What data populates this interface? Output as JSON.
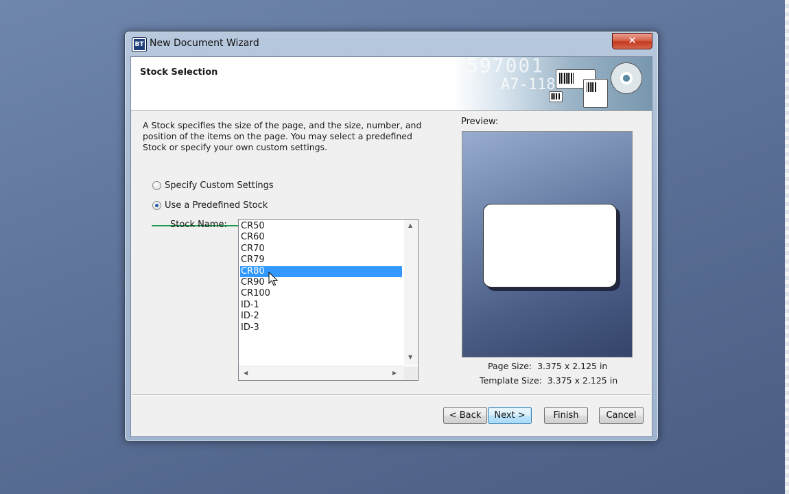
{
  "window": {
    "title": "New Document Wizard",
    "close_glyph": "✕",
    "app_icon_text": "BT"
  },
  "header": {
    "title": "Stock Selection",
    "banner_text_1": "597001",
    "banner_text_2": "A7-118"
  },
  "description": "A Stock specifies the size of the page, and the size, number, and position of the items on the page. You may select a predefined Stock or specify your own custom settings.",
  "options": {
    "custom_label": "Specify Custom Settings",
    "predefined_label": "Use a Predefined Stock",
    "selected": "predefined"
  },
  "stock": {
    "label": "Stock Name:",
    "items": [
      "CR50",
      "CR60",
      "CR70",
      "CR79",
      "CR80",
      "CR90",
      "CR100",
      "ID-1",
      "ID-2",
      "ID-3"
    ],
    "selected_index": 4
  },
  "preview": {
    "label": "Preview:",
    "page_size_label": "Page Size:",
    "page_size_value": "3.375 x 2.125 in",
    "template_size_label": "Template Size:",
    "template_size_value": "3.375 x 2.125 in"
  },
  "buttons": {
    "back": "< Back",
    "next": "Next >",
    "finish": "Finish",
    "cancel": "Cancel"
  },
  "colors": {
    "selection": "#3399ff",
    "annotation_underline": "#1f9a4d"
  }
}
